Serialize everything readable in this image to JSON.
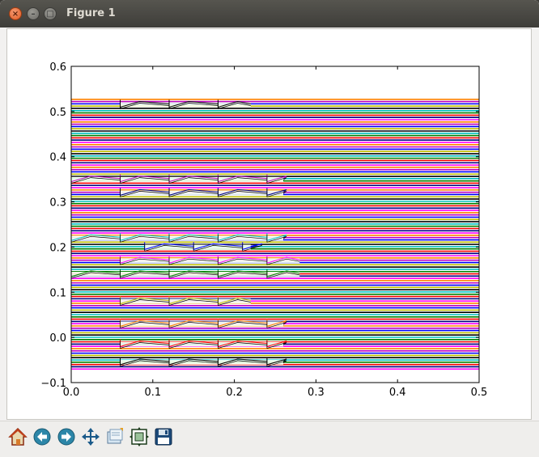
{
  "window": {
    "title": "Figure 1",
    "close_glyph": "×",
    "minimize_glyph": "–",
    "maximize_glyph": "□"
  },
  "toolbar": {
    "buttons": [
      {
        "name": "home-button",
        "icon": "home-icon"
      },
      {
        "name": "back-button",
        "icon": "arrow-left-icon"
      },
      {
        "name": "forward-button",
        "icon": "arrow-right-icon"
      },
      {
        "name": "pan-button",
        "icon": "move-arrows-icon"
      },
      {
        "name": "zoom-rect-button",
        "icon": "zoom-rectangle-icon"
      },
      {
        "name": "subplots-button",
        "icon": "configure-subplots-icon"
      },
      {
        "name": "save-button",
        "icon": "floppy-disk-icon"
      }
    ]
  },
  "chart_data": {
    "type": "line",
    "title": "",
    "xlabel": "",
    "ylabel": "",
    "xlim": [
      0.0,
      0.5
    ],
    "ylim": [
      -0.1,
      0.6
    ],
    "xticks": [
      "0.0",
      "0.1",
      "0.2",
      "0.3",
      "0.4",
      "0.5"
    ],
    "yticks": [
      "−0.1",
      "0.0",
      "0.1",
      "0.2",
      "0.3",
      "0.4",
      "0.5",
      "0.6"
    ],
    "xtick_values": [
      0.0,
      0.1,
      0.2,
      0.3,
      0.4,
      0.5
    ],
    "ytick_values": [
      -0.1,
      0.0,
      0.1,
      0.2,
      0.3,
      0.4,
      0.5,
      0.6
    ],
    "grid": false,
    "legend": "none",
    "series_y_range": [
      -0.07,
      0.527
    ],
    "series_count": 120,
    "series_x_range": [
      0.0,
      0.5
    ],
    "colors": [
      "#ff00ff",
      "#000080",
      "#ff0000",
      "#008000",
      "#00bfbf",
      "#000000",
      "#bfbf00",
      "#0000ff",
      "#bf00bf",
      "#ff8000"
    ],
    "wiggle_clusters": [
      {
        "y": 0.515,
        "x_start": 0.06,
        "x_end": 0.22
      },
      {
        "y": 0.35,
        "x_start": 0.0,
        "x_end": 0.26
      },
      {
        "y": 0.32,
        "x_start": 0.06,
        "x_end": 0.26
      },
      {
        "y": 0.22,
        "x_start": 0.0,
        "x_end": 0.26
      },
      {
        "y": 0.2,
        "x_start": 0.09,
        "x_end": 0.22
      },
      {
        "y": 0.17,
        "x_start": 0.06,
        "x_end": 0.28
      },
      {
        "y": 0.14,
        "x_start": 0.0,
        "x_end": 0.28
      },
      {
        "y": 0.08,
        "x_start": 0.06,
        "x_end": 0.22
      },
      {
        "y": 0.03,
        "x_start": 0.06,
        "x_end": 0.26
      },
      {
        "y": -0.015,
        "x_start": 0.06,
        "x_end": 0.26
      },
      {
        "y": -0.055,
        "x_start": 0.06,
        "x_end": 0.26
      }
    ]
  }
}
